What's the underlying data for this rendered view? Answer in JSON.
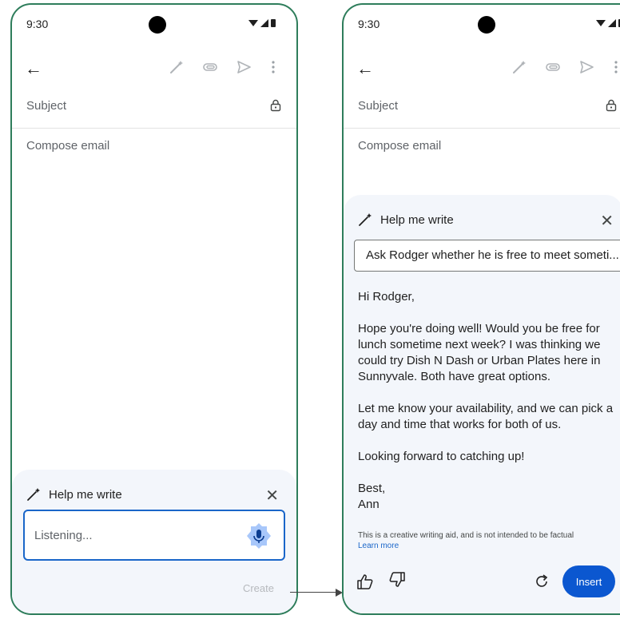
{
  "left": {
    "status_time": "9:30",
    "subject_placeholder": "Subject",
    "compose_placeholder": "Compose email",
    "help_title": "Help me write",
    "listening_text": "Listening...",
    "create_label": "Create"
  },
  "right": {
    "status_time": "9:30",
    "subject_placeholder": "Subject",
    "compose_placeholder": "Compose email",
    "help_title": "Help me write",
    "prompt_text": "Ask Rodger whether he is free to meet someti...",
    "draft": {
      "greeting": "Hi Rodger,",
      "para1": "Hope you're doing well! Would you be free for lunch sometime next week? I was thinking we could try Dish N Dash or Urban Plates here in Sunnyvale. Both have great options.",
      "para2": "Let me know your availability, and we can pick a day and time that works for both of us.",
      "para3": "Looking forward to catching up!",
      "signoff": "Best,",
      "name": "Ann"
    },
    "disclaimer": "This is a creative writing aid, and is not intended to be factual",
    "learn_more": "Learn more",
    "insert_label": "Insert"
  },
  "icons": {
    "back": "arrow-left-icon",
    "magic_pen": "magic-pen-icon",
    "attach": "paperclip-icon",
    "send": "send-icon",
    "more": "more-vert-icon",
    "lock": "lock-icon",
    "close": "close-icon",
    "mic": "mic-icon",
    "thumbs_up": "thumbs-up-icon",
    "thumbs_down": "thumbs-down-icon",
    "refresh": "refresh-icon"
  },
  "colors": {
    "frame": "#2e7d5b",
    "accent": "#0b57d0",
    "panel_bg": "#f3f6fb",
    "mic_bg": "#a8c7fa"
  }
}
